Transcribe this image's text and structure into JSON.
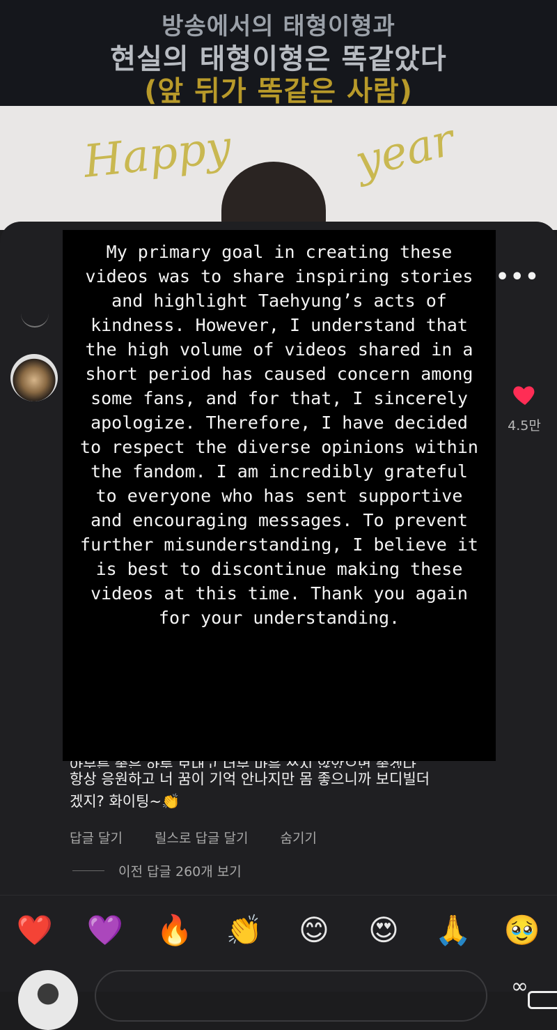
{
  "video": {
    "caption_line1": "방송에서의 태형이형과",
    "caption_line2": "현실의 태형이형은 똑같았다",
    "caption_line3": "(앞 뒤가 똑같은 사람)",
    "banner_text_left": "Happy",
    "banner_text_right": "year"
  },
  "header": {
    "more_icon": "•••"
  },
  "statement": {
    "text": "My primary goal in creating these videos was to share inspiring stories and highlight Taehyung’s acts of kindness. However, I understand that the high volume of videos shared in a short period has caused concern among some fans, and for that, I sincerely apologize. Therefore, I have decided to respect the diverse opinions within the fandom. I am incredibly grateful to everyone who has sent supportive and encouraging messages. To prevent further misunderstanding, I believe it is best to discontinue making these videos at this time. Thank you again for your understanding."
  },
  "comment": {
    "partial_line": "아무튼 좋은 하루 보내고 너무 마음 쓰지 않았으면 좋겠다",
    "line2": "항상 응원하고 너 꿈이 기억 안나지만 몸 좋으니까 보디빌더",
    "line3": "겠지? 화이팅~👏",
    "like_count": "4.5만",
    "heart_color": "#ff2d55",
    "actions": {
      "reply": "답글 달기",
      "reply_reels": "릴스로 답글 달기",
      "hide": "숨기기"
    },
    "view_replies": "이전 답글 260개 보기"
  },
  "emoji_bar": [
    "❤️",
    "💜",
    "🔥",
    "👏",
    "😊",
    "😍",
    "🙏",
    "🥹"
  ]
}
